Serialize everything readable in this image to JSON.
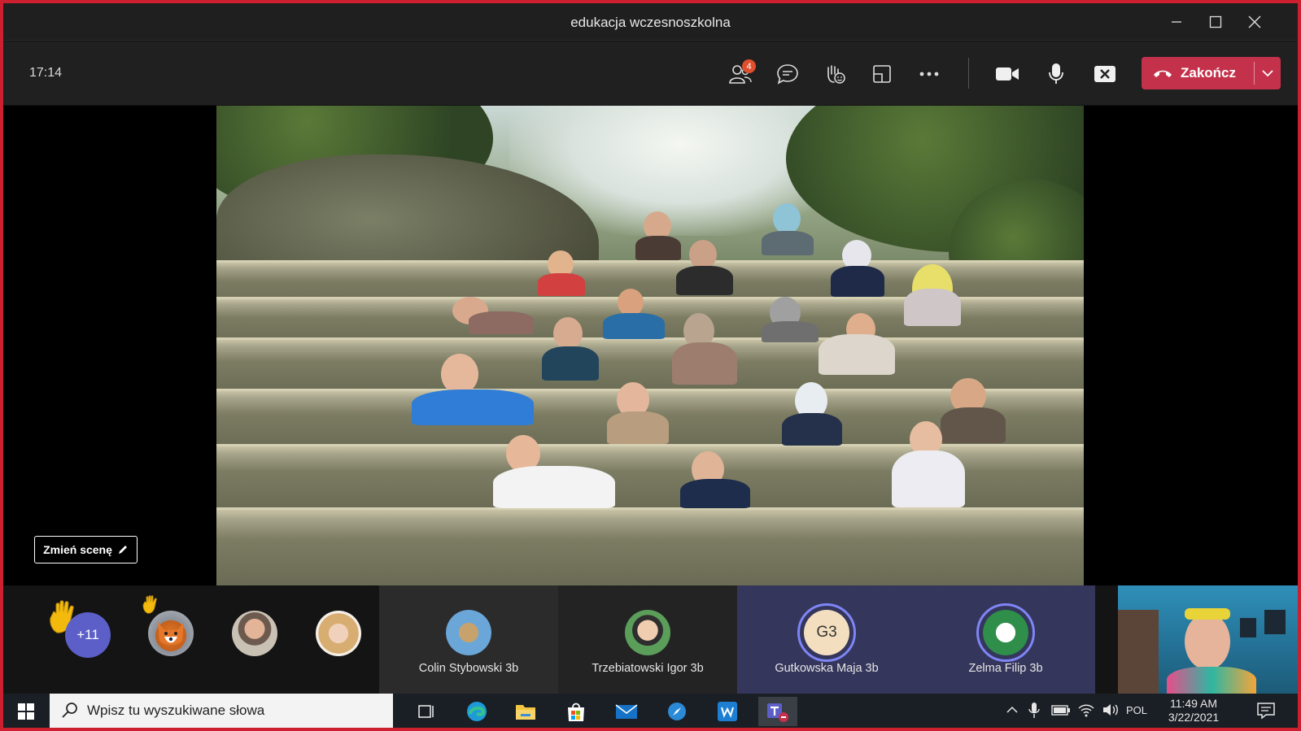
{
  "window": {
    "title": "edukacja wczesnoszkolna"
  },
  "toolbar": {
    "timer": "17:14",
    "participants_badge": "4",
    "end_call_label": "Zakończ"
  },
  "stage": {
    "change_scene_label": "Zmień scenę"
  },
  "participants": {
    "overflow_label": "+11",
    "tiles": [
      {
        "name": "Colin Stybowski 3b"
      },
      {
        "name": "Trzebiatowski Igor 3b"
      },
      {
        "name": "Gutkowska Maja 3b",
        "initials": "G3"
      },
      {
        "name": "Zelma Filip 3b"
      }
    ]
  },
  "taskbar": {
    "search_placeholder": "Wpisz tu wyszukiwane słowa",
    "language": "POL",
    "time": "11:49 AM",
    "date": "3/22/2021"
  },
  "colors": {
    "end_call": "#c4314b",
    "badge": "#e04f2e",
    "speaking_ring": "#7f85f5",
    "window_border": "#cc1f2f"
  }
}
